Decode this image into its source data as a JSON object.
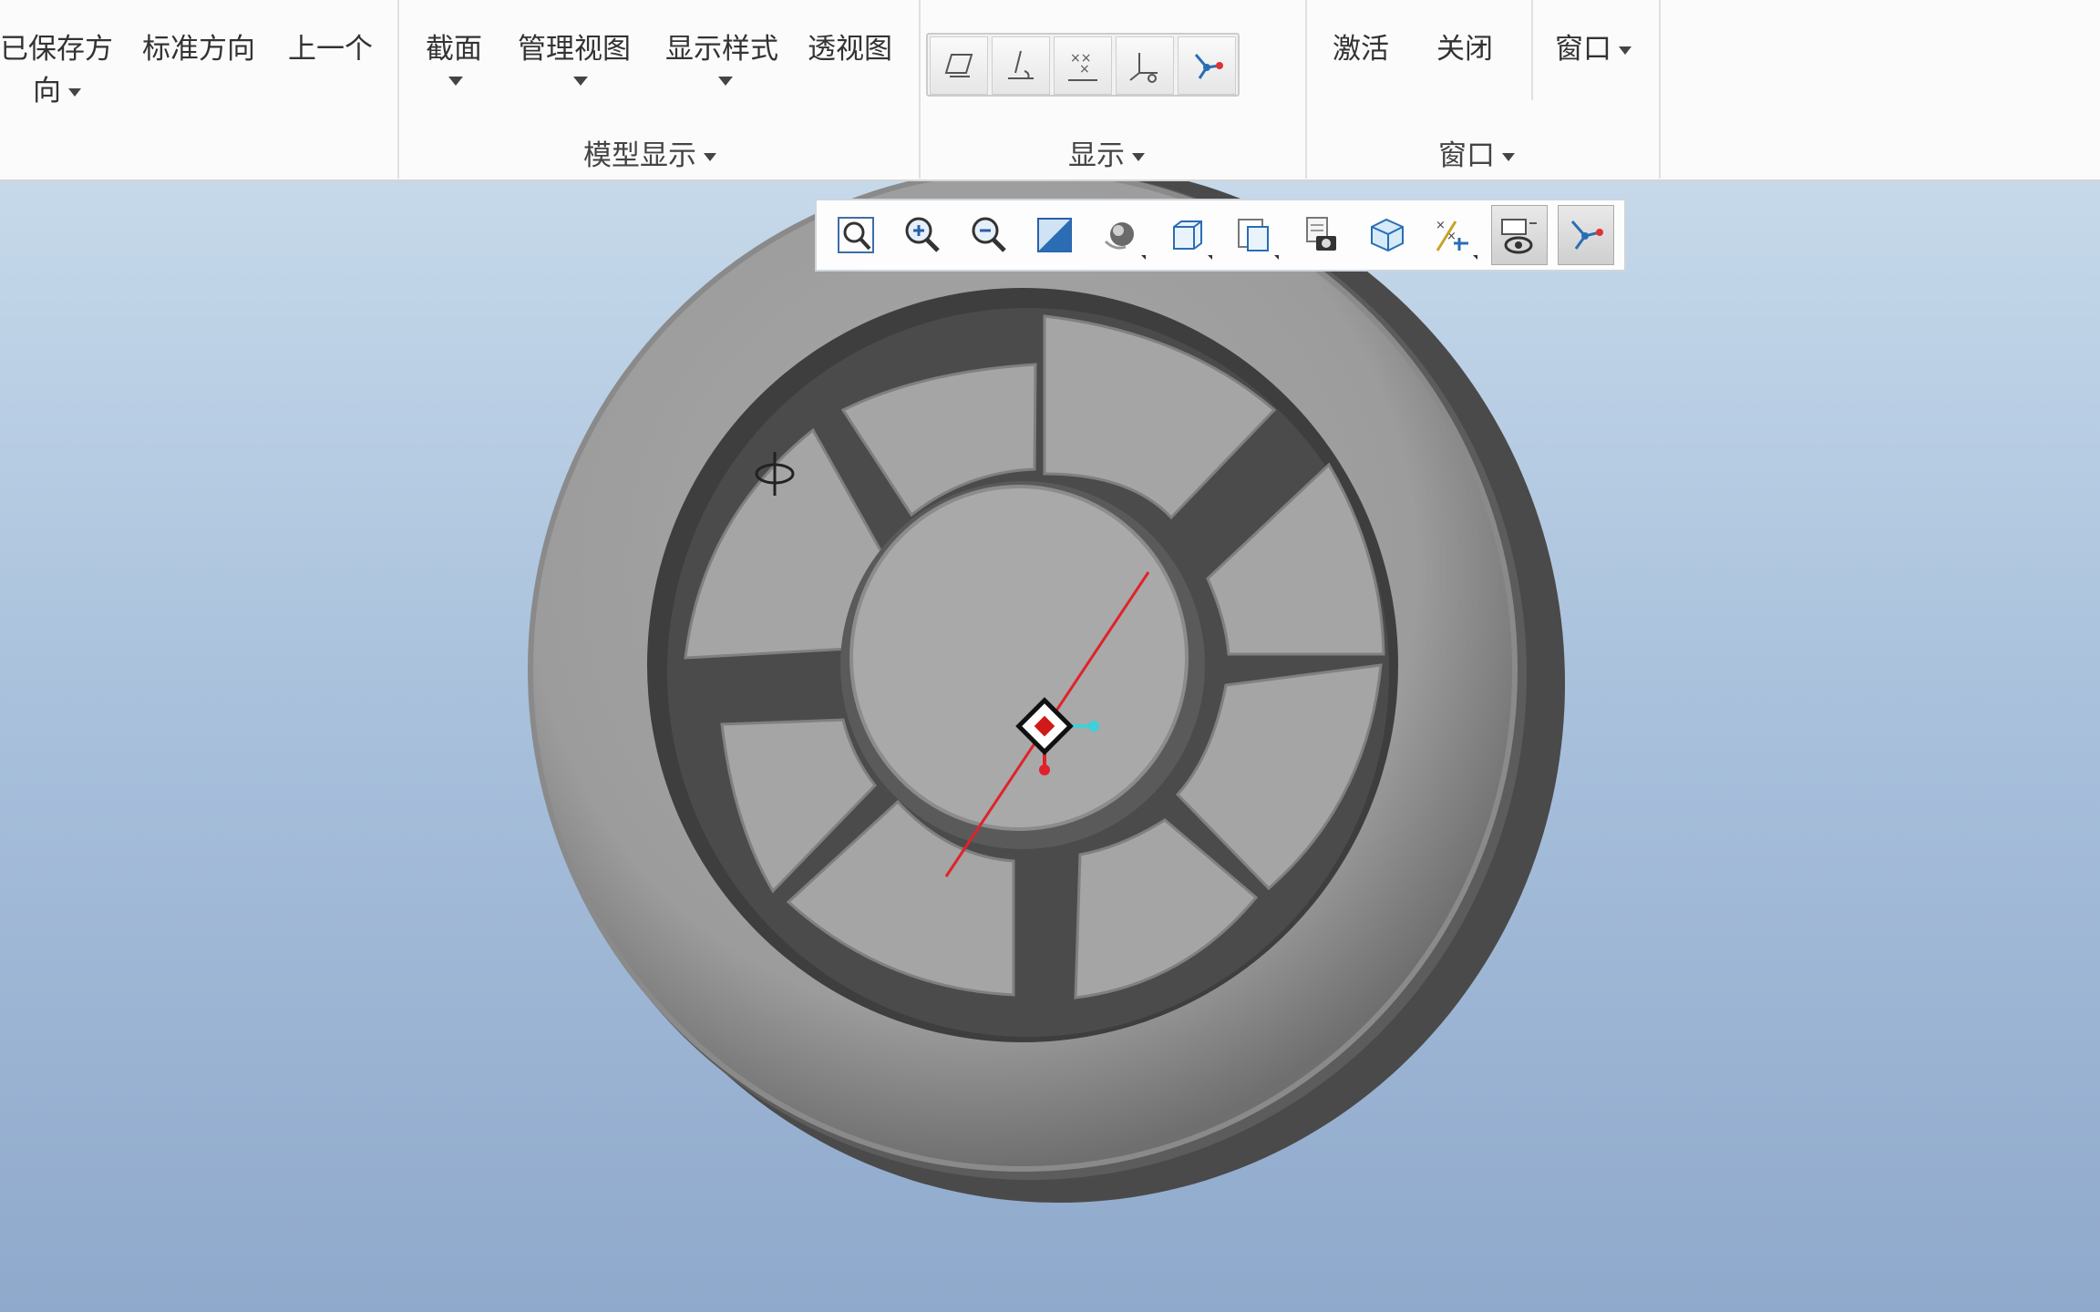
{
  "ribbon": {
    "orientation": {
      "saved_line1": "已保存方",
      "saved_line2": "向",
      "standard": "标准方向",
      "previous": "上一个"
    },
    "model_display": {
      "section": "截面",
      "manage_views": "管理视图",
      "display_style": "显示样式",
      "perspective": "透视图",
      "group_label": "模型显示"
    },
    "show": {
      "group_label": "显示",
      "icons": [
        "datum-plane-display-icon",
        "datum-axis-display-icon",
        "datum-point-display-icon",
        "coordinate-system-display-icon",
        "spin-center-icon"
      ]
    },
    "window": {
      "activate": "激活",
      "close": "关闭",
      "windows": "窗口",
      "group_label": "窗口"
    }
  },
  "graphics_toolbar": {
    "icons": [
      "refit-icon",
      "zoom-in-icon",
      "zoom-out-icon",
      "repaint-icon",
      "display-style-icon",
      "saved-orientations-icon",
      "view-manager-icon",
      "perspective-camera-icon",
      "section-view-icon",
      "datum-display-filters-icon",
      "annotation-display-icon",
      "spin-center-icon"
    ],
    "active": [
      "annotation-display-icon",
      "spin-center-icon"
    ]
  },
  "colors": {
    "viewport_top": "#c6d9ea",
    "viewport_bottom": "#8fa9cc",
    "model_face": "#a6a6a6",
    "model_dark": "#4a4a4a",
    "axis_red": "#e0222a",
    "axis_cyan": "#3fd0d8"
  }
}
